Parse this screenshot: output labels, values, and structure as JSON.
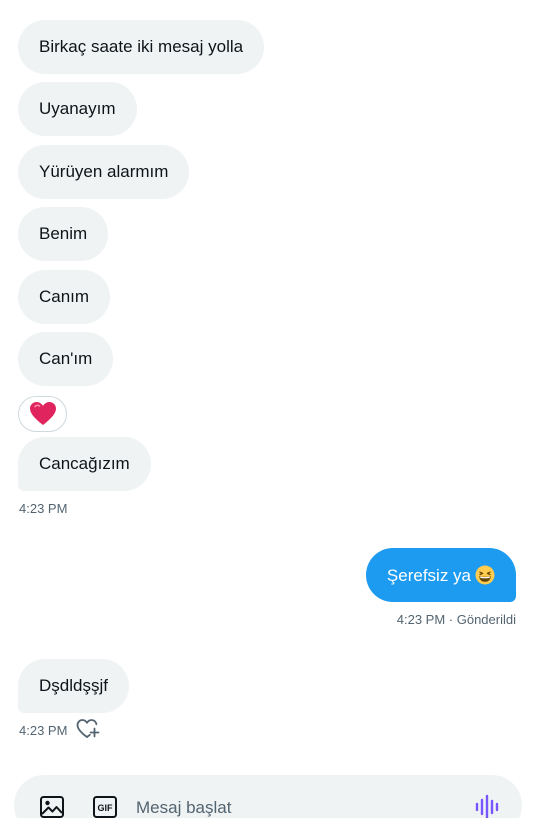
{
  "messages": {
    "m1": "Birkaç saate iki mesaj yolla",
    "m2": "Uyanayım",
    "m3": "Yürüyen alarmım",
    "m4": "Benim",
    "m5": "Canım",
    "m6": "Can'ım",
    "m7": "Cancağızım",
    "m8": "Şerefsiz ya",
    "m9": "Dşdldşşjf"
  },
  "timestamps": {
    "t1": "4:23 PM",
    "t2": "4:23 PM · Gönderildi",
    "t3": "4:23 PM"
  },
  "reaction": {
    "icon": "red-heart-emoji"
  },
  "outgoing_emoji": {
    "icon": "grinning-squinting-face-emoji"
  },
  "composer": {
    "placeholder": "Mesaj başlat",
    "gif_label": "GIF"
  },
  "colors": {
    "incoming_bubble": "#eff3f4",
    "outgoing_bubble": "#1d9bf0",
    "voice_icon": "#7856ff"
  }
}
